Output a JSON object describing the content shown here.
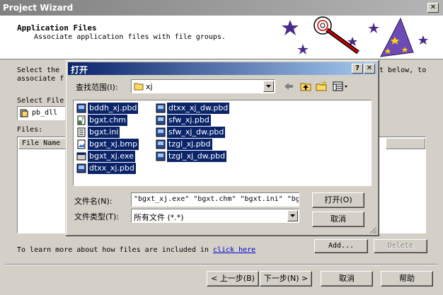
{
  "wizard": {
    "title": "Project Wizard",
    "close_glyph": "✕",
    "header_title": "Application Files",
    "header_subtitle": "Associate application files with file groups.",
    "intro_left_line1": "Select the ",
    "intro_left_line2": "associate f",
    "intro_right_line1": "t below, to",
    "intro_right_line2": "",
    "select_file_label": "Select File",
    "select_file_value": "pb_dll",
    "files_label": "Files:",
    "files_column_header": "File Name",
    "learn_more_text": "To learn more about how files are included in ",
    "learn_more_link": "click here",
    "add_button": "Add...",
    "delete_button": "Delete",
    "back_button": "< 上一步(B)",
    "next_button": "下一步(N) >",
    "cancel_button": "取消",
    "help_button": "帮助"
  },
  "dialog": {
    "title": "打开",
    "help_glyph": "?",
    "close_glyph": "✕",
    "look_in_label": "查找范围(I):",
    "look_in_value": "xj",
    "files": [
      {
        "name": "bddh_xj.pbd",
        "icon": "pbd-icon"
      },
      {
        "name": "bgxt.chm",
        "icon": "help-file-icon"
      },
      {
        "name": "bgxt.ini",
        "icon": "ini-file-icon"
      },
      {
        "name": "bgxt_xj.bmp",
        "icon": "bmp-file-icon"
      },
      {
        "name": "bgxt_xj.exe",
        "icon": "exe-file-icon"
      },
      {
        "name": "dtxx_xj.pbd",
        "icon": "pbd-icon"
      },
      {
        "name": "dtxx_xj_dw.pbd",
        "icon": "pbd-icon"
      },
      {
        "name": "sfw_xj.pbd",
        "icon": "pbd-icon"
      },
      {
        "name": "sfw_xj_dw.pbd",
        "icon": "pbd-icon"
      },
      {
        "name": "tzgl_xj.pbd",
        "icon": "pbd-icon"
      },
      {
        "name": "tzgl_xj_dw.pbd",
        "icon": "pbd-icon"
      }
    ],
    "filename_label": "文件名(N):",
    "filename_value": "\"bgxt_xj.exe\" \"bgxt.chm\" \"bgxt.ini\" \"bg",
    "filetype_label": "文件类型(T):",
    "filetype_value": "所有文件 (*.*)",
    "open_button": "打开(O)",
    "cancel_button": "取消"
  },
  "colors": {
    "selection": "#0a246a",
    "face": "#d4d0c8",
    "link": "#0000cc"
  }
}
